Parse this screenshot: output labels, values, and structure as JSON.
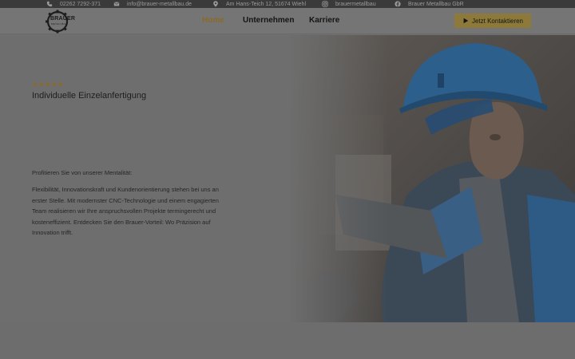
{
  "topbar": {
    "phone": "02262 7292-371",
    "email": "info@brauer-metallbau.de",
    "address": "Am Hans-Teich 12, 51674 Wiehl",
    "instagram": "brauermetallbau",
    "facebook": "Brauer Metallbau GbR",
    "icons": [
      "phone-icon",
      "envelope-icon",
      "map-pin-icon",
      "instagram-icon",
      "facebook-icon"
    ]
  },
  "logo": {
    "text": "BRAUER",
    "sub": "METALLBAU"
  },
  "nav": {
    "items": [
      {
        "label": "Home",
        "active": true
      },
      {
        "label": "Unternehmen",
        "active": false
      },
      {
        "label": "Karriere",
        "active": false
      }
    ],
    "cta_label": "Jetzt Kontaktieren"
  },
  "hero": {
    "rating": 5,
    "title": "Individuelle Einzelanfertigung",
    "subheading": "Profitieren Sie von unserer Mentalität:",
    "paragraph": "Flexibilität, Innovationskraft und Kundenorientierung stehen bei uns an erster Stelle. Mit modernster CNC-Technologie und einem engagierten Team realisieren wir Ihre anspruchsvollen Projekte termingerecht und kosteneffizient. Entdecken Sie den Brauer-Vorteil: Wo Präzision auf Innovation trifft."
  },
  "colors": {
    "accent": "#8d7a3b",
    "active_nav": "#8a6a28",
    "overlay": "#6e6e6e"
  }
}
